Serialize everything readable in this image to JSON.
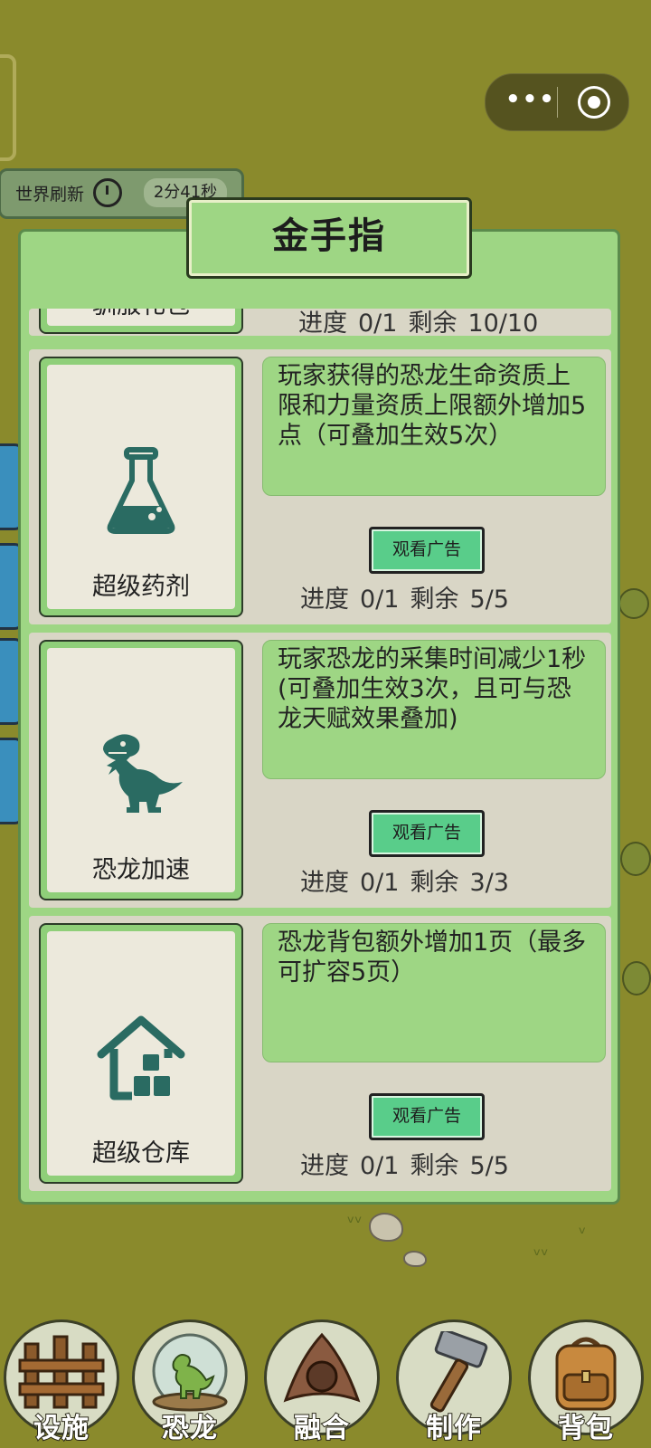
{
  "capsule": {
    "more_icon": "more-dots-icon",
    "close_icon": "target-close-icon"
  },
  "world_refresh": {
    "label": "世界刷新",
    "time": "2分41秒",
    "icon": "stopwatch-icon"
  },
  "modal": {
    "title": "金手指",
    "items": [
      {
        "name": "驯服礼包",
        "icon": "gift-icon",
        "description": "",
        "button": "",
        "progress_label": "进度",
        "progress": "0/1",
        "remaining_label": "剩余",
        "remaining": "10/10"
      },
      {
        "name": "超级药剂",
        "icon": "flask-icon",
        "description": "玩家获得的恐龙生命资质上限和力量资质上限额外增加5点（可叠加生效5次）",
        "button": "观看广告",
        "progress_label": "进度",
        "progress": "0/1",
        "remaining_label": "剩余",
        "remaining": "5/5"
      },
      {
        "name": "恐龙加速",
        "icon": "dinosaur-icon",
        "description": "玩家恐龙的采集时间减少1秒(可叠加生效3次，且可与恐龙天赋效果叠加)",
        "button": "观看广告",
        "progress_label": "进度",
        "progress": "0/1",
        "remaining_label": "剩余",
        "remaining": "3/3"
      },
      {
        "name": "超级仓库",
        "icon": "warehouse-icon",
        "description": "恐龙背包额外增加1页（最多可扩容5页）",
        "button": "观看广告",
        "progress_label": "进度",
        "progress": "0/1",
        "remaining_label": "剩余",
        "remaining": "5/5"
      }
    ]
  },
  "nav": [
    {
      "label": "设施",
      "icon": "fence-icon"
    },
    {
      "label": "恐龙",
      "icon": "dino-globe-icon"
    },
    {
      "label": "融合",
      "icon": "fusion-orb-icon"
    },
    {
      "label": "制作",
      "icon": "hammer-icon"
    },
    {
      "label": "背包",
      "icon": "backpack-icon"
    }
  ]
}
